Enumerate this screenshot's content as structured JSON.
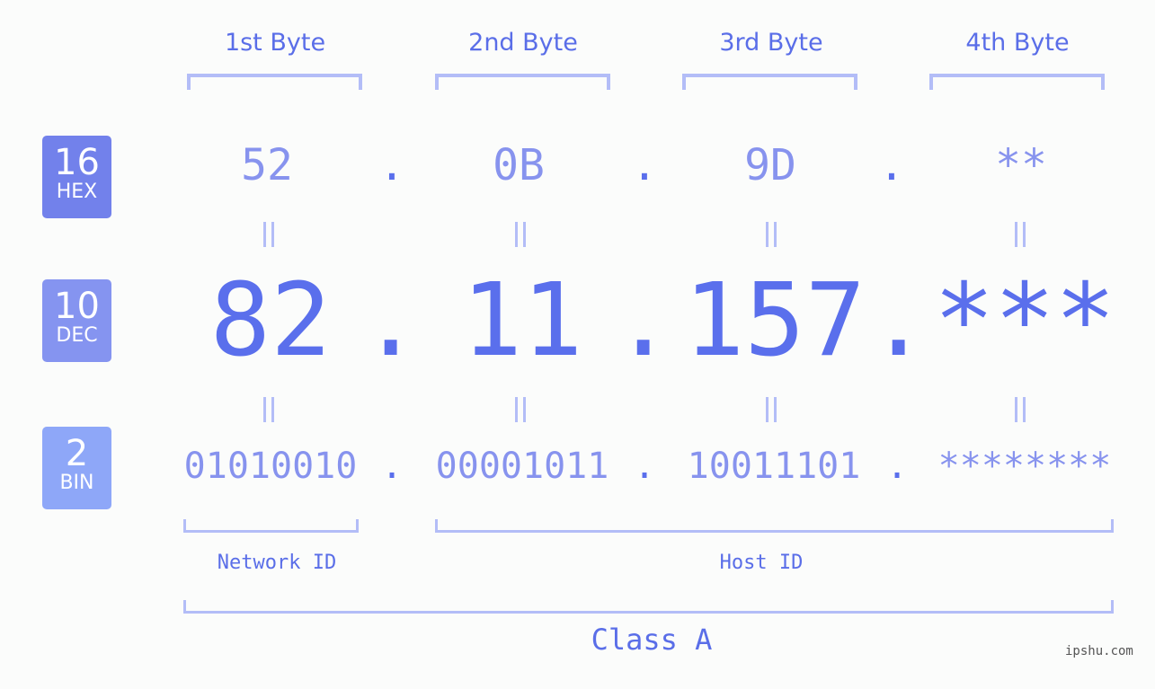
{
  "bytes": [
    {
      "header": "1st Byte",
      "hex": "52",
      "dec": "82",
      "bin": "01010010"
    },
    {
      "header": "2nd Byte",
      "hex": "0B",
      "dec": "11",
      "bin": "00001011"
    },
    {
      "header": "3rd Byte",
      "hex": "9D",
      "dec": "157",
      "bin": "10011101"
    },
    {
      "header": "4th Byte",
      "hex": "**",
      "dec": "***",
      "bin": "********"
    }
  ],
  "separator": ".",
  "badges": {
    "hex": {
      "num": "16",
      "label": "HEX",
      "color": "#7281eb"
    },
    "dec": {
      "num": "10",
      "label": "DEC",
      "color": "#8594f0"
    },
    "bin": {
      "num": "2",
      "label": "BIN",
      "color": "#8ea7f8"
    }
  },
  "network_id_label": "Network ID",
  "host_id_label": "Host ID",
  "class_label": "Class A",
  "watermark": "ipshu.com",
  "colors": {
    "primary": "#5a6fec",
    "value": "#8793ee",
    "bracket": "#b3bdf7",
    "background": "#fbfcfb"
  }
}
